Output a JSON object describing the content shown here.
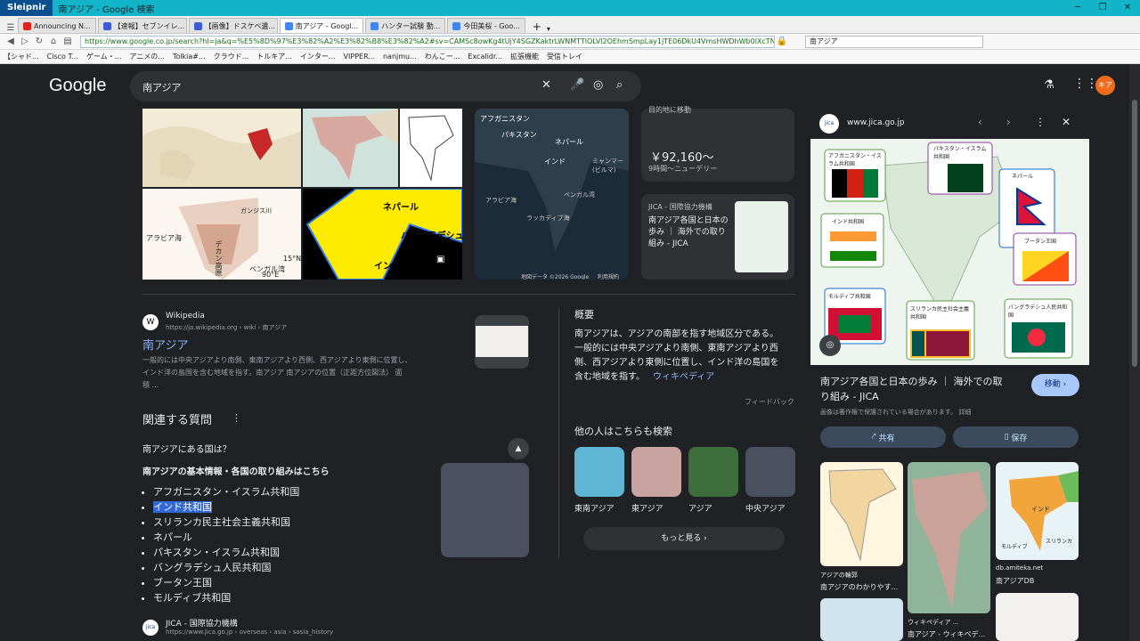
{
  "window": {
    "app": "Sleipnir",
    "title": "南アジア - Google 検索"
  },
  "tabs": [
    {
      "label": "Announcing N...",
      "color": "#e62117"
    },
    {
      "label": "【速報】セブンイレ...",
      "color": "#3b5bdb"
    },
    {
      "label": "【画像】ドスケベ遺...",
      "color": "#3b5bdb"
    },
    {
      "label": "南アジア - Googl...",
      "color": "#4285f4"
    },
    {
      "label": "ハンター試験 動...",
      "color": "#4285f4"
    },
    {
      "label": "今田美桜 - Goo...",
      "color": "#4285f4"
    }
  ],
  "nav": {
    "url": "https://www.google.co.jp/search?hl=ja&q=%E5%8D%97%E3%82%A2%E3%82%B8%E3%82%A2#sv=CAMSc8owKg4tUjY4SGZKaktrLWNMTTlOLVl2OEhmSmpLay1jTE06DkU4VmsHWDhWb0lXcTNNIAQqOAokC",
    "search_box": "南アジア"
  },
  "bookmarks": [
    "【シャド...",
    "Cisco T...",
    "ゲーム・...",
    "アニメの...",
    "Tolkia#...",
    "クラウド...",
    "トルキア...",
    "インター...",
    "VIPPER...",
    "nanjmu...",
    "わんこー...",
    "Excalidr...",
    "拡張機能",
    "受信トレイ"
  ],
  "google": {
    "logo": "Google",
    "query": "南アジア",
    "avatar": "キア"
  },
  "images": {
    "labels": [
      "ネパール",
      "バングラデシュ",
      "インド",
      "アラビア海",
      "デカン高原",
      "ベンガル湾",
      "ガンジス川",
      "15°N",
      "90°E",
      "アフガニスタン",
      "パキスタン",
      "ネパール",
      "インド",
      "アラビア海",
      "ベンガル湾",
      "ラッカディブ海",
      "ミャンマー(ビルマ)",
      "地図データ ©2026 Google",
      "利用規約"
    ]
  },
  "flight": {
    "move": "目的地に移動",
    "price": "￥92,160〜",
    "detail": "9時間〜ニューデリー"
  },
  "jica_card": {
    "source": "JICA - 国際協力機構",
    "title": "南アジア各国と日本の歩み ｜ 海外での取り組み - JICA"
  },
  "wiki": {
    "site": "Wikipedia",
    "url": "https://ja.wikipedia.org › wiki › 南アジア",
    "title": "南アジア",
    "snippet1": "一般的には中央アジアより南側、東南アジアより西側、西アジアより東側に位置し、",
    "snippet2": "インド洋の島国を含む地域を指す。南アジア 南アジアの位置（正距方位図法） 面",
    "snippet3": "積 ..."
  },
  "paa": {
    "heading": "関連する質問",
    "question": "南アジアにある国は？",
    "answer_title": "南アジアの基本情報・各国の取り組みはこちら",
    "items": [
      "アフガニスタン・イスラム共和国",
      "インド共和国",
      "スリランカ民主社会主義共和国",
      "ネパール",
      "パキスタン・イスラム共和国",
      "バングラデシュ人民共和国",
      "ブータン王国",
      "モルディブ共和国"
    ]
  },
  "jica_result": {
    "site": "JICA - 国際協力機構",
    "url": "https://www.jica.go.jp › overseas › asia › sasia_history"
  },
  "overview": {
    "heading": "概要",
    "text1": "南アジアは、アジアの南部を指す地域区分である。",
    "text2": "一般的には中央アジアより南側、東南アジアより西",
    "text3": "側、西アジアより東側に位置し、インド洋の島国を",
    "text4": "含む地域を指す。",
    "wiki_link": "ウィキペディア",
    "feedback": "フィードバック"
  },
  "related": {
    "heading": "他の人はこちらも検索",
    "items": [
      "東南アジア",
      "東アジア",
      "アジア",
      "中央アジア"
    ],
    "more": "もっと見る"
  },
  "side": {
    "site": "www.jica.go.jp",
    "title1": "南アジア各国と日本の歩み ｜ 海外での取",
    "title2": "り組み - JICA",
    "visit": "移動",
    "note": "画像は著作権で保護されている場合があります。 詳細",
    "share": "共有",
    "save": "保存",
    "map_labels": [
      "アフガニスタン・イスラム共和国",
      "パキスタン・イスラム共和国",
      "ネパール",
      "インド共和国",
      "ブータン王国",
      "モルディブ共和国",
      "スリランカ民主社会主義共和国",
      "バングラデシュ人民共和国"
    ],
    "thumbs": [
      {
        "site": "アジアの輪郭",
        "title": "南アジアのわかりやす..."
      },
      {
        "site": "ウィキペディア ...",
        "title": "南アジア - ウィキペデ..."
      },
      {
        "site": "db.amiteka.net",
        "title": "南アジアDB"
      }
    ],
    "map_thumb_labels": [
      "インド",
      "モルディブ",
      "スリランカ"
    ]
  }
}
